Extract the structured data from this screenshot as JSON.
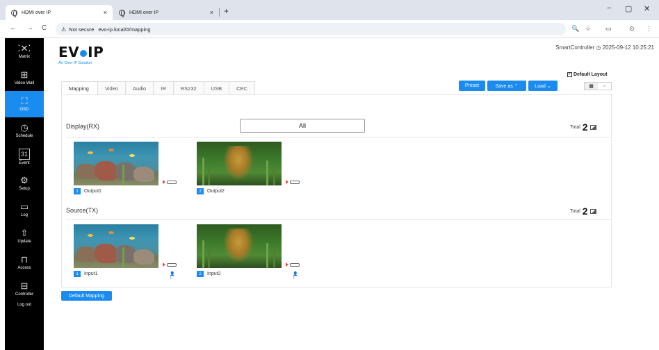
{
  "browser": {
    "tabs": [
      {
        "title": "HDMI over IP",
        "active": true
      },
      {
        "title": "HDMI over IP",
        "active": false
      }
    ],
    "close_glyph": "×",
    "new_tab_glyph": "+",
    "address": {
      "warning_icon": "⚠",
      "not_secure": "Not secure",
      "url": "evo-ip.local/#/mapping"
    },
    "nav": {
      "back": "←",
      "forward": "→",
      "reload": "C"
    },
    "window": {
      "minimize": "−",
      "restore": "▢",
      "close": "✕"
    },
    "tools": {
      "zoom": "🔍",
      "star": "☆",
      "reader": "▭",
      "profile": "⊙",
      "menu": "⋮"
    }
  },
  "sidebar": {
    "items": [
      {
        "label": "Matrix",
        "icon": "matrix-icon",
        "glyph": "⁚✕⁚",
        "active": false
      },
      {
        "label": "Video Wall",
        "icon": "video-wall-icon",
        "glyph": "⊞",
        "active": false
      },
      {
        "label": "OSD",
        "icon": "osd-icon",
        "glyph": "⛶",
        "active": true
      },
      {
        "label": "Schedule",
        "icon": "clock-icon",
        "glyph": "◷",
        "active": false
      },
      {
        "label": "Event",
        "icon": "calendar-icon",
        "glyph": "31",
        "active": false
      },
      {
        "label": "Setup",
        "icon": "gear-icon",
        "glyph": "⚙",
        "active": false
      },
      {
        "label": "Log",
        "icon": "folder-icon",
        "glyph": "▭",
        "active": false
      },
      {
        "label": "Update",
        "icon": "upload-icon",
        "glyph": "⇧",
        "active": false
      },
      {
        "label": "Access",
        "icon": "lock-icon",
        "glyph": "⊓",
        "active": false
      },
      {
        "label": "Controller",
        "icon": "controller-icon",
        "glyph": "⊟",
        "active": false
      },
      {
        "label": "Log out",
        "icon": "",
        "glyph": "",
        "active": false
      }
    ]
  },
  "header": {
    "logo_text_1": "EV",
    "logo_text_2": "IP",
    "logo_sub": "AV Over IP Solution",
    "controller_name": "SmartController",
    "clock_icon": "◷",
    "datetime": "2025-09-12 10:25:21"
  },
  "layout": {
    "default_layout_label": "Default Layout",
    "default_layout_checked": true,
    "grid_icon": "▦",
    "list_icon": "≡"
  },
  "tabs": [
    "Mapping",
    "Video",
    "Audio",
    "IR",
    "RS232",
    "USB",
    "CEC"
  ],
  "actions": {
    "preset": "Preset",
    "save_as": "Save as ⌃",
    "load": "Load ⌄"
  },
  "display": {
    "title": "Display(RX)",
    "filter_value": "All",
    "total_label": "Total",
    "total": "2",
    "items": [
      {
        "index": "1",
        "name": "Output1",
        "thumb": "aquarium"
      },
      {
        "index": "2",
        "name": "Output2",
        "thumb": "dragon"
      }
    ]
  },
  "source": {
    "title": "Source(TX)",
    "total_label": "Total",
    "total": "2",
    "items": [
      {
        "index": "1",
        "name": "Input1",
        "thumb": "aquarium",
        "users": "1"
      },
      {
        "index": "2",
        "name": "Input2",
        "thumb": "dragon",
        "users": "1"
      }
    ]
  },
  "user_icon": "👤",
  "default_mapping": "Default Mapping",
  "colors": {
    "accent": "#1a8cf0",
    "sidebar": "#000000",
    "port_arrow": "#e74c3c"
  }
}
